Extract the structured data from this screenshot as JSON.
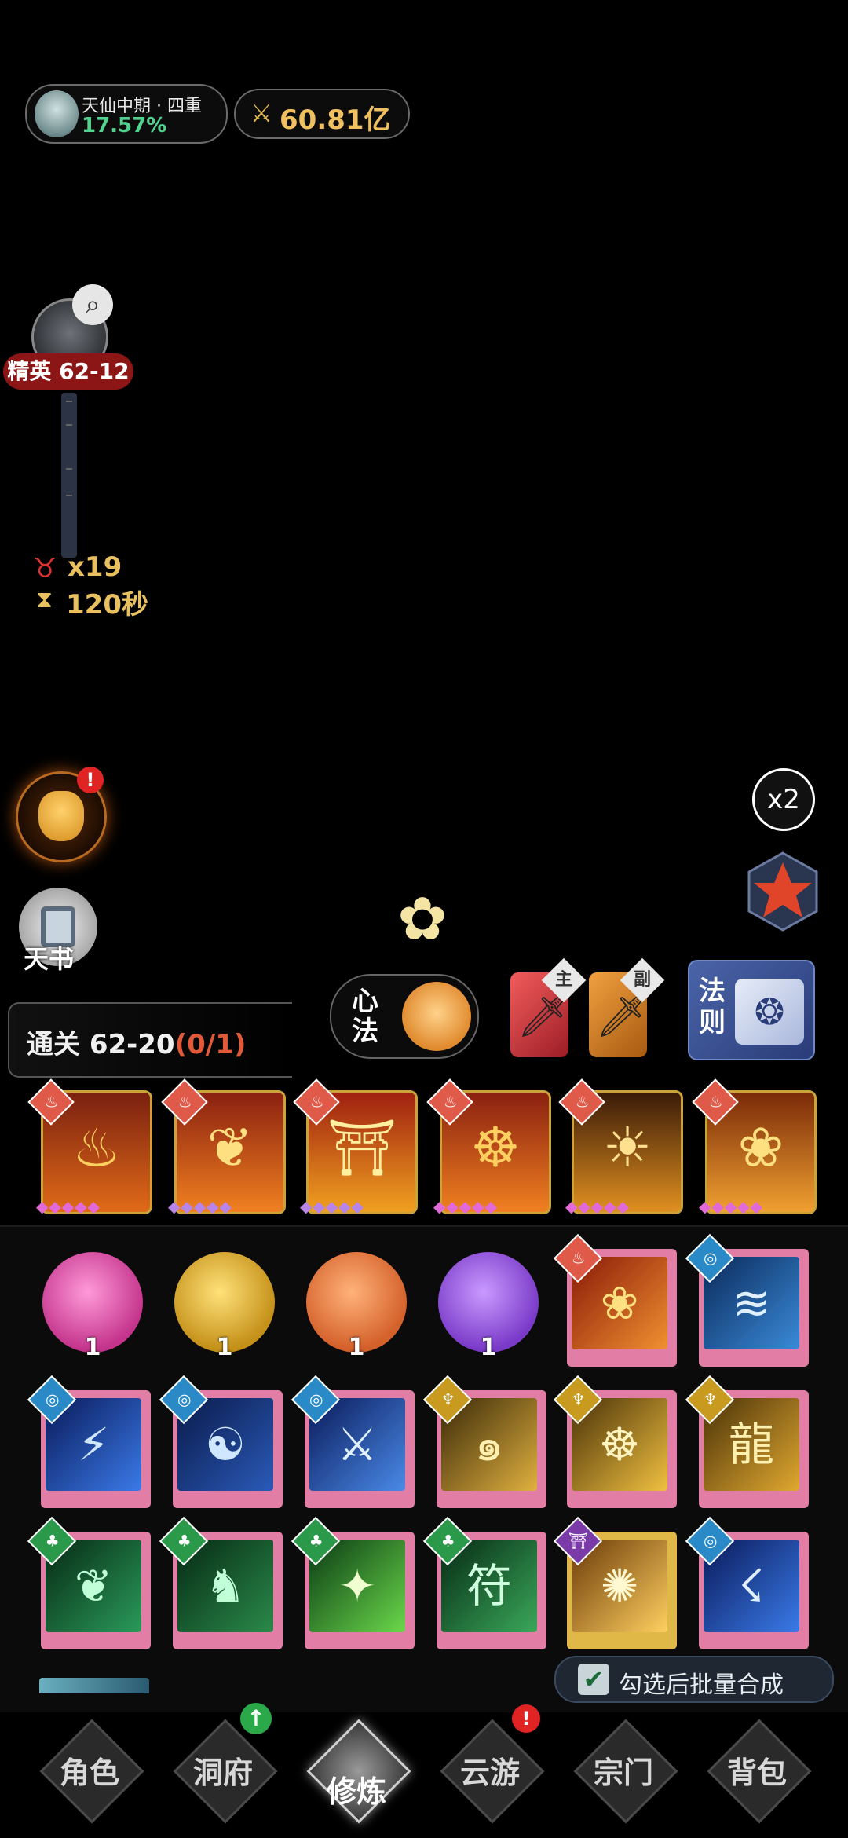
{
  "status": {
    "realm": "天仙中期 · 四重",
    "realm_progress": "17.57%",
    "power": "60.81亿"
  },
  "stage": {
    "label": "精英 62-12",
    "enemy_count": "x19",
    "timer": "120秒"
  },
  "side_buttons": {
    "tianshu_label": "天书",
    "speed_label": "x2"
  },
  "battle": {
    "clear_label": "通关 62-20",
    "clear_progress": "(0/1)",
    "xinfa_label": "心法",
    "weapon_main_tag": "主",
    "weapon_sub_tag": "副",
    "fazhe_label": "法则"
  },
  "inventory": {
    "orb_counts": [
      "1",
      "1",
      "1",
      "1"
    ],
    "batch_label": "勾选后批量合成"
  },
  "nav": {
    "role": "角色",
    "dongfu": "洞府",
    "xiulian": "修炼",
    "yunyou": "云游",
    "zongmen": "宗门",
    "beibao": "背包",
    "dongfu_badge": "↑",
    "yunyou_badge": "!"
  },
  "colors": {
    "realm_progress": "#4fd38e",
    "power": "#f0c060",
    "stage_label_bg": "#8c1616",
    "clear_progress": "#e05a3a",
    "book_frame": "#e27ea6"
  }
}
